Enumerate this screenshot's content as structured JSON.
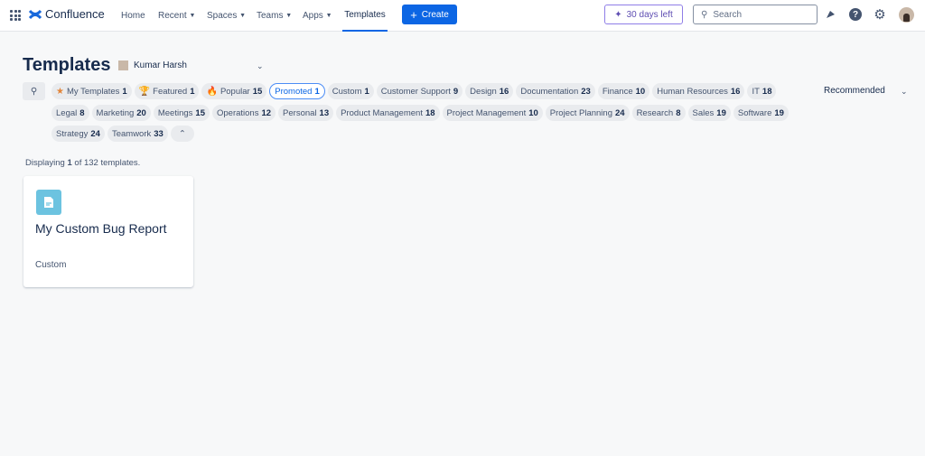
{
  "header": {
    "app_name": "Confluence",
    "nav": [
      {
        "label": "Home"
      },
      {
        "label": "Recent"
      },
      {
        "label": "Spaces"
      },
      {
        "label": "Teams"
      },
      {
        "label": "Apps"
      },
      {
        "label": "Templates"
      }
    ],
    "create_label": "Create",
    "trial_label": "30 days left",
    "search_placeholder": "Search",
    "accent": "#0c66e4"
  },
  "page": {
    "title": "Templates",
    "owner": "Kumar Harsh",
    "sort_label": "Recommended",
    "display_prefix": "Displaying",
    "display_count": "1",
    "display_suffix": "of 132 templates."
  },
  "filters": [
    {
      "label": "My Templates",
      "count": "1",
      "icon": "star-icon"
    },
    {
      "label": "Featured",
      "count": "1",
      "icon": "trophy-icon"
    },
    {
      "label": "Popular",
      "count": "15",
      "icon": "fire-icon"
    },
    {
      "label": "Promoted",
      "count": "1",
      "selected": true
    },
    {
      "label": "Custom",
      "count": "1"
    },
    {
      "label": "Customer Support",
      "count": "9"
    },
    {
      "label": "Design",
      "count": "16"
    },
    {
      "label": "Documentation",
      "count": "23"
    },
    {
      "label": "Finance",
      "count": "10"
    },
    {
      "label": "Human Resources",
      "count": "16"
    },
    {
      "label": "IT",
      "count": "18"
    },
    {
      "label": "Legal",
      "count": "8"
    },
    {
      "label": "Marketing",
      "count": "20"
    },
    {
      "label": "Meetings",
      "count": "15"
    },
    {
      "label": "Operations",
      "count": "12"
    },
    {
      "label": "Personal",
      "count": "13"
    },
    {
      "label": "Product Management",
      "count": "18"
    },
    {
      "label": "Project Management",
      "count": "10"
    },
    {
      "label": "Project Planning",
      "count": "24"
    },
    {
      "label": "Research",
      "count": "8"
    },
    {
      "label": "Sales",
      "count": "19"
    },
    {
      "label": "Software",
      "count": "19"
    },
    {
      "label": "Strategy",
      "count": "24"
    },
    {
      "label": "Teamwork",
      "count": "33"
    }
  ],
  "templates": [
    {
      "title": "My Custom Bug Report",
      "category": "Custom",
      "icon": "document-icon"
    }
  ]
}
